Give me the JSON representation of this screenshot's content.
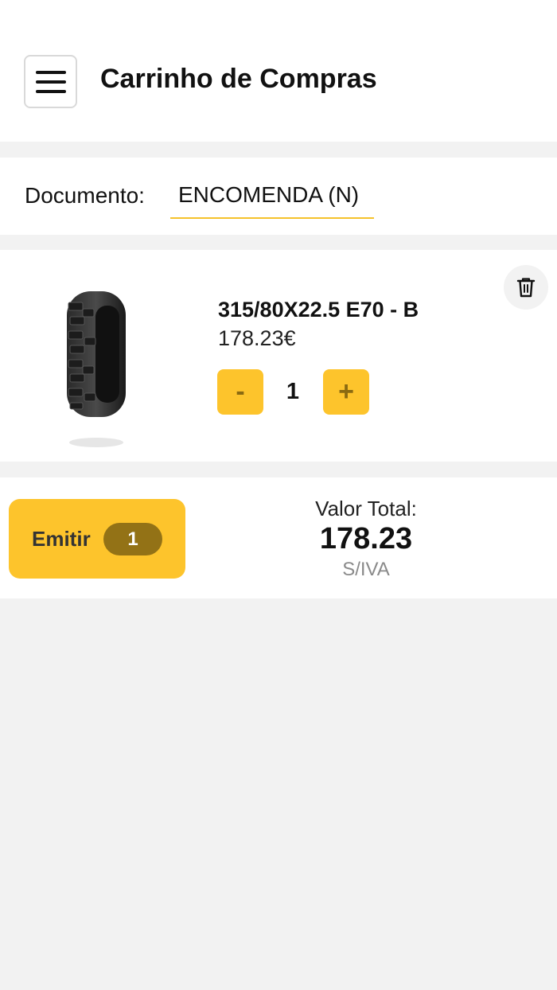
{
  "header": {
    "title": "Carrinho de Compras",
    "menu_icon": "hamburger-menu-icon"
  },
  "document": {
    "label": "Documento:",
    "value": "ENCOMENDA (N)"
  },
  "cart": {
    "items": [
      {
        "name": "315/80X22.5 E70 - B",
        "price": "178.23€",
        "quantity": "1",
        "minus_label": "-",
        "plus_label": "+"
      }
    ]
  },
  "footer": {
    "emit_label": "Emitir",
    "emit_count": "1",
    "total_label": "Valor Total:",
    "total_value": "178.23",
    "tax_note": "S/IVA"
  },
  "colors": {
    "accent": "#fdc42c",
    "badge": "#937216",
    "background": "#f2f2f2"
  }
}
